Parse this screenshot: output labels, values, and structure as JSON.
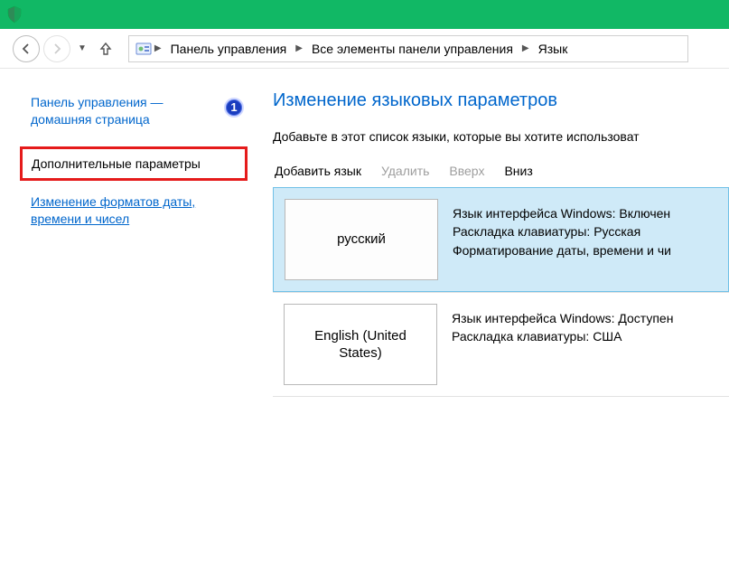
{
  "breadcrumb": {
    "items": [
      "Панель управления",
      "Все элементы панели управления",
      "Язык"
    ]
  },
  "sidebar": {
    "home": "Панель управления — домашняя страница",
    "step_badge": "1",
    "highlighted": "Дополнительные параметры",
    "link_dates": "Изменение форматов даты, времени и чисел"
  },
  "main": {
    "heading": "Изменение языковых параметров",
    "subtext": "Добавьте в этот список языки, которые вы хотите использоват",
    "toolbar": {
      "add": "Добавить язык",
      "remove": "Удалить",
      "up": "Вверх",
      "down": "Вниз"
    },
    "languages": [
      {
        "name": "русский",
        "info": "Язык интерфейса Windows: Включен\nРаскладка клавиатуры: Русская\nФорматирование даты, времени и чи",
        "selected": true
      },
      {
        "name": "English (United States)",
        "info": "Язык интерфейса Windows: Доступен\nРаскладка клавиатуры: США",
        "selected": false
      }
    ]
  }
}
